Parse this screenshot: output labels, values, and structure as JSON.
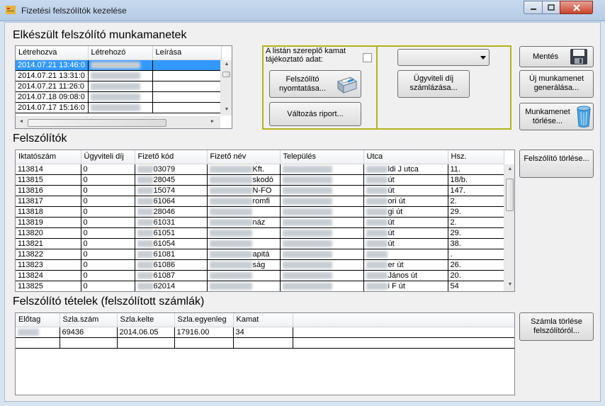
{
  "window": {
    "title": "Fizetési felszólítók kezelése"
  },
  "sessions": {
    "title": "Elkészült felszólító munkamanetek",
    "columns": [
      "Létrehozva",
      "Létrehozó",
      "Leírása"
    ],
    "rows": [
      {
        "created": "2014.07.21 13:46:0",
        "creator": "",
        "desc": ""
      },
      {
        "created": "2014.07.21 13:31:0",
        "creator": "",
        "desc": ""
      },
      {
        "created": "2014.07.21 11:26:0",
        "creator": "",
        "desc": ""
      },
      {
        "created": "2014.07.18 09:08:0",
        "creator": "",
        "desc": ""
      },
      {
        "created": "2014.07.17 15:16:0",
        "creator": "",
        "desc": ""
      }
    ]
  },
  "options": {
    "interest_label": "A listán szereplő kamat tájékoztató adat:",
    "print_label": "Felszólító nyomtatása...",
    "change_report_label": "Változás riport...",
    "fee_billing_label": "Ügyviteli díj számlázása...",
    "combo_value": ""
  },
  "actions": {
    "save_label": "Mentés",
    "new_session_label": "Új munkamenet generálása...",
    "delete_session_label": "Munkamenet törlése...",
    "delete_notice_label": "Felszólító törlése...",
    "delete_invoice_label": "Számla törlése felszólítóról..."
  },
  "notices": {
    "title": "Felszólítók",
    "columns": [
      "Iktatószám",
      "Ügyviteli díj",
      "Fizető kód",
      "Fizető név",
      "Település",
      "Utca",
      "Hsz."
    ],
    "rows": [
      {
        "id": "113814",
        "fee": "0",
        "code": "03079",
        "name": "Kft.",
        "street": "ldi J utca",
        "no": "11."
      },
      {
        "id": "113815",
        "fee": "0",
        "code": "28045",
        "name": "skodó",
        "street": "út",
        "no": "18/b."
      },
      {
        "id": "113816",
        "fee": "0",
        "code": "15074",
        "name": "N-FO",
        "street": "út",
        "no": "147."
      },
      {
        "id": "113817",
        "fee": "0",
        "code": "61064",
        "name": "romfi",
        "street": "ori út",
        "no": "2."
      },
      {
        "id": "113818",
        "fee": "0",
        "code": "28046",
        "name": "",
        "street": "gi út",
        "no": "29."
      },
      {
        "id": "113819",
        "fee": "0",
        "code": "61031",
        "name": "náz",
        "street": "út",
        "no": "2."
      },
      {
        "id": "113820",
        "fee": "0",
        "code": "61051",
        "name": "",
        "street": "út",
        "no": "29."
      },
      {
        "id": "113821",
        "fee": "0",
        "code": "61054",
        "name": "",
        "street": "út",
        "no": "38."
      },
      {
        "id": "113822",
        "fee": "0",
        "code": "61081",
        "name": "apitá",
        "street": "",
        "no": "."
      },
      {
        "id": "113823",
        "fee": "0",
        "code": "61086",
        "name": "ság",
        "street": "er út",
        "no": "26."
      },
      {
        "id": "113824",
        "fee": "0",
        "code": "61087",
        "name": "",
        "street": "János út",
        "no": "20."
      },
      {
        "id": "113825",
        "fee": "0",
        "code": "62014",
        "name": "",
        "street": "i F út",
        "no": "54"
      }
    ]
  },
  "items": {
    "title": "Felszólító tételek (felszólított számlák)",
    "columns": [
      "Előtag",
      "Szla.szám",
      "Szla.kelte",
      "Szla.egyenleg",
      "Kamat"
    ],
    "rows": [
      {
        "prefix": "",
        "number": "69436",
        "date": "2014.06.05",
        "balance": "17916.00",
        "interest": "34"
      }
    ]
  }
}
